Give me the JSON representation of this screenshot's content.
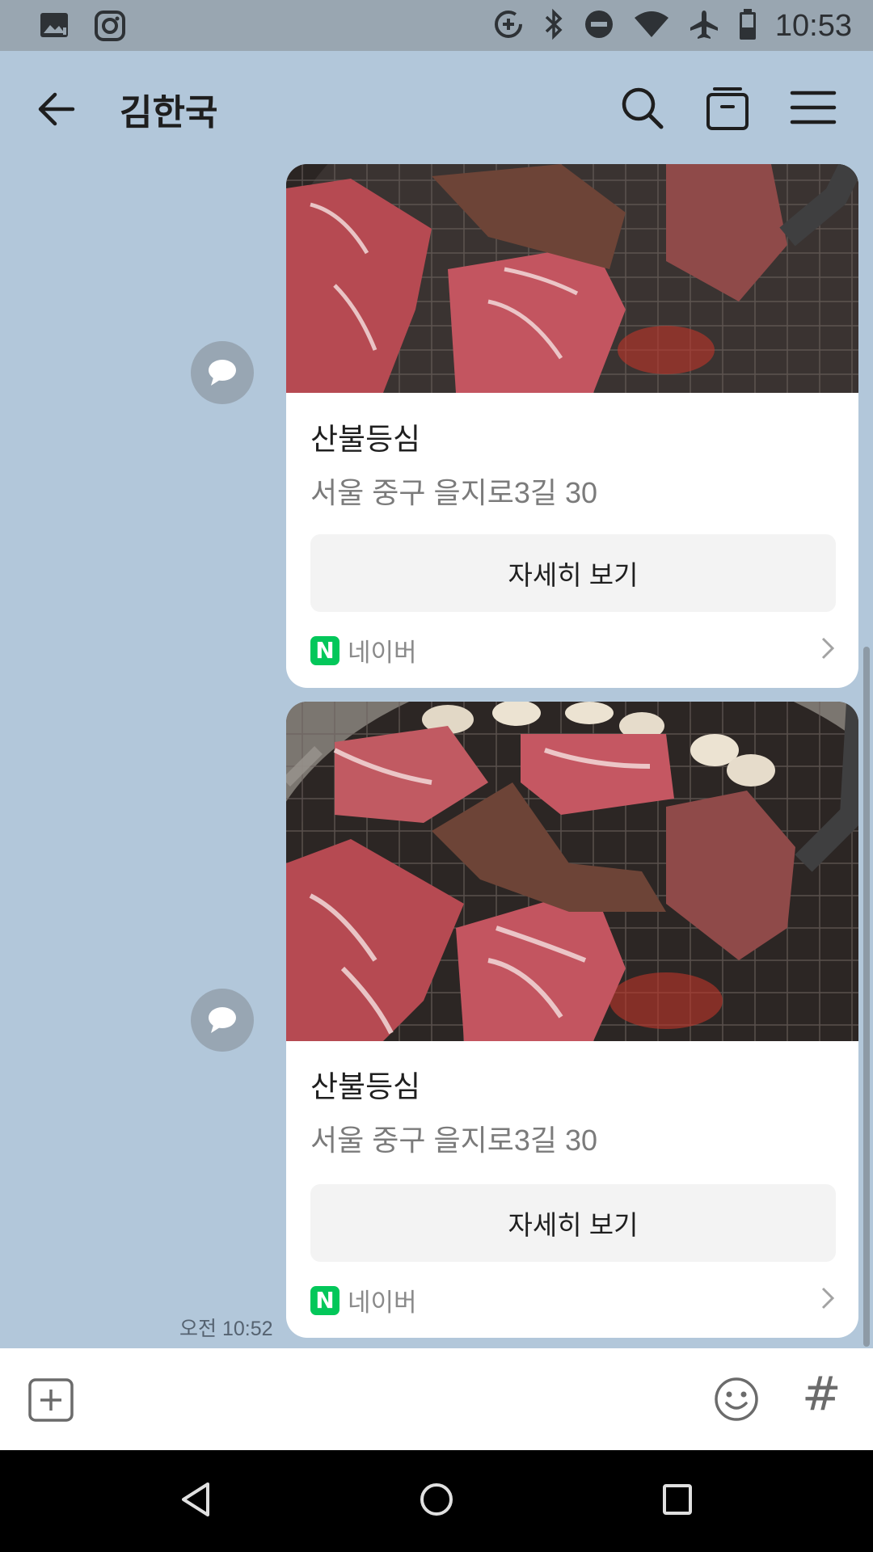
{
  "status_bar": {
    "time": "10:53",
    "icons": [
      "gallery-icon",
      "instagram-icon",
      "data-saver-icon",
      "bluetooth-icon",
      "do-not-disturb-icon",
      "wifi-icon",
      "airplane-icon",
      "battery-icon"
    ]
  },
  "header": {
    "title": "김한국",
    "icons": [
      "back-arrow-icon",
      "search-icon",
      "drawer-icon",
      "menu-icon"
    ]
  },
  "messages": [
    {
      "place_name": "산불등심",
      "address": "서울 중구 을지로3길 30",
      "button_label": "자세히 보기",
      "source_label": "네이버",
      "source_logo": "N"
    },
    {
      "place_name": "산불등심",
      "address": "서울 중구 을지로3길 30",
      "button_label": "자세히 보기",
      "source_label": "네이버",
      "source_logo": "N"
    }
  ],
  "timestamp": "오전 10:52",
  "input_bar": {
    "icons": [
      "add-icon",
      "emoji-icon",
      "hashtag-icon"
    ],
    "hashtag_glyph": "#"
  },
  "nav_bar": {
    "icons": [
      "back-triangle-icon",
      "home-circle-icon",
      "recents-square-icon"
    ]
  },
  "colors": {
    "chat_bg": "#b2c7da",
    "status_bar": "#99a6b1",
    "naver_green": "#03c75a"
  }
}
